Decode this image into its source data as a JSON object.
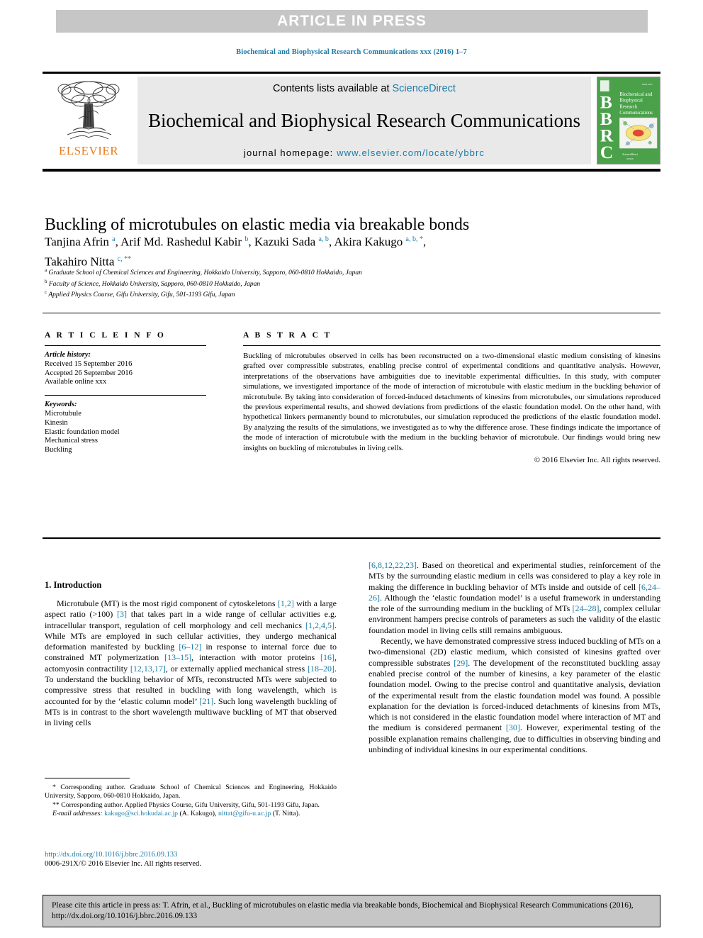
{
  "banner": {
    "label": "ARTICLE IN PRESS"
  },
  "running_head": "Biochemical and Biophysical Research Communications xxx (2016) 1–7",
  "masthead": {
    "contents_prefix": "Contents lists available at ",
    "sciencedirect": "ScienceDirect",
    "journal_title": "Biochemical and Biophysical Research Communications",
    "homepage_label": "journal homepage: ",
    "homepage_url": "www.elsevier.com/locate/ybbrc",
    "publisher": "ELSEVIER",
    "cover": {
      "letters": "BBRC",
      "title_lines": [
        "Biochemical and",
        "Biophysical",
        "Research",
        "Communications"
      ],
      "bg_color": "#4aa14a"
    }
  },
  "article": {
    "title": "Buckling of microtubules on elastic media via breakable bonds",
    "authors_line1_part1": "Tanjina Afrin ",
    "authors_line1_sup1": "a",
    "authors_line1_part2": ", Arif Md. Rashedul Kabir ",
    "authors_line1_sup2": "b",
    "authors_line1_part3": ", Kazuki Sada ",
    "authors_line1_sup3": "a, b",
    "authors_line1_part4": ", Akira Kakugo ",
    "authors_line1_sup4": "a, b, *",
    "authors_line1_part5": ",",
    "authors_line2_part1": "Takahiro Nitta ",
    "authors_line2_sup1": "c, **",
    "affiliations": [
      {
        "marker": "a",
        "text": "Graduate School of Chemical Sciences and Engineering, Hokkaido University, Sapporo, 060-0810 Hokkaido, Japan"
      },
      {
        "marker": "b",
        "text": "Faculty of Science, Hokkaido University, Sapporo, 060-0810 Hokkaido, Japan"
      },
      {
        "marker": "c",
        "text": "Applied Physics Course, Gifu University, Gifu, 501-1193 Gifu, Japan"
      }
    ]
  },
  "article_info": {
    "heading": "A R T I C L E  I N F O",
    "history_label": "Article history:",
    "history": [
      "Received 15 September 2016",
      "Accepted 26 September 2016",
      "Available online xxx"
    ],
    "keywords_label": "Keywords:",
    "keywords": [
      "Microtubule",
      "Kinesin",
      "Elastic foundation model",
      "Mechanical stress",
      "Buckling"
    ]
  },
  "abstract": {
    "heading": "A B S T R A C T",
    "text": "Buckling of microtubules observed in cells has been reconstructed on a two-dimensional elastic medium consisting of kinesins grafted over compressible substrates, enabling precise control of experimental conditions and quantitative analysis. However, interpretations of the observations have ambiguities due to inevitable experimental difficulties. In this study, with computer simulations, we investigated importance of the mode of interaction of microtubule with elastic medium in the buckling behavior of microtubule. By taking into consideration of forced-induced detachments of kinesins from microtubules, our simulations reproduced the previous experimental results, and showed deviations from predictions of the elastic foundation model. On the other hand, with hypothetical linkers permanently bound to microtubules, our simulation reproduced the predictions of the elastic foundation model. By analyzing the results of the simulations, we investigated as to why the difference arose. These findings indicate the importance of the mode of interaction of microtubule with the medium in the buckling behavior of microtubule. Our findings would bring new insights on buckling of microtubules in living cells.",
    "copyright": "© 2016 Elsevier Inc. All rights reserved."
  },
  "body": {
    "section_title": "1.  Introduction",
    "left_par1_a": "Microtubule (MT) is the most rigid component of cytoskeletons ",
    "left_par1_r1": "[1,2]",
    "left_par1_b": " with a large aspect ratio (>100) ",
    "left_par1_r2": "[3]",
    "left_par1_c": " that takes part in a wide range of cellular activities e.g. intracellular transport, regulation of cell morphology and cell mechanics ",
    "left_par1_r3": "[1,2,4,5]",
    "left_par1_d": ". While MTs are employed in such cellular activities, they undergo mechanical deformation manifested by buckling ",
    "left_par1_r4": "[6–12]",
    "left_par1_e": " in response to internal force due to constrained MT polymerization ",
    "left_par1_r5": "[13–15]",
    "left_par1_f": ", interaction with motor proteins ",
    "left_par1_r6": "[16]",
    "left_par1_g": ", actomyosin contractility ",
    "left_par1_r7": "[12,13,17]",
    "left_par1_h": ", or externally applied mechanical stress ",
    "left_par1_r8": "[18–20]",
    "left_par1_i": ". To understand the buckling behavior of MTs, reconstructed MTs were subjected to compressive stress that resulted in buckling with long wavelength, which is accounted for by the ‘elastic column model’ ",
    "left_par1_r9": "[21]",
    "left_par1_j": ". Such long wavelength buckling of MTs is in contrast to the short wavelength multiwave buckling of MT that observed in living cells",
    "right_par1_r1": "[6,8,12,22,23]",
    "right_par1_a": ". Based on theoretical and experimental studies, reinforcement of the MTs by the surrounding elastic medium in cells was considered to play a key role in making the difference in buckling behavior of MTs inside and outside of cell ",
    "right_par1_r2": "[6,24–26]",
    "right_par1_b": ". Although the ‘elastic foundation model’ is a useful framework in understanding the role of the surrounding medium in the buckling of MTs ",
    "right_par1_r3": "[24–28]",
    "right_par1_c": ", complex cellular environment hampers precise controls of parameters as such the validity of the elastic foundation model in living cells still remains ambiguous.",
    "right_par2_a": "Recently, we have demonstrated compressive stress induced buckling of MTs on a two-dimensional (2D) elastic medium, which consisted of kinesins grafted over compressible substrates ",
    "right_par2_r1": "[29]",
    "right_par2_b": ". The development of the reconstituted buckling assay enabled precise control of the number of kinesins, a key parameter of the elastic foundation model. Owing to the precise control and quantitative analysis, deviation of the experimental result from the elastic foundation model was found. A possible explanation for the deviation is forced-induced detachments of kinesins from MTs, which is not considered in the elastic foundation model where interaction of MT and the medium is considered permanent ",
    "right_par2_r2": "[30]",
    "right_par2_c": ". However, experimental testing of the possible explanation remains challenging, due to difficulties in observing binding and unbinding of individual kinesins in our experimental conditions."
  },
  "footnotes": {
    "fn1": "* Corresponding author. Graduate School of Chemical Sciences and Engineering, Hokkaido University, Sapporo, 060-0810 Hokkaido, Japan.",
    "fn2": "** Corresponding author. Applied Physics Course, Gifu University, Gifu, 501-1193 Gifu, Japan.",
    "email_label": "E-mail addresses:",
    "email1": "kakugo@sci.hokudai.ac.jp",
    "email1_name": "(A. Kakugo)",
    "email2": "nittat@gifu-u.ac.jp",
    "email2_name": "(T. Nitta)."
  },
  "doi_block": {
    "doi_url": "http://dx.doi.org/10.1016/j.bbrc.2016.09.133",
    "issn_line": "0006-291X/© 2016 Elsevier Inc. All rights reserved."
  },
  "cite_box": {
    "text": "Please cite this article in press as: T. Afrin, et al., Buckling of microtubules on elastic media via breakable bonds, Biochemical and Biophysical Research Communications (2016), http://dx.doi.org/10.1016/j.bbrc.2016.09.133"
  },
  "colors": {
    "link": "#1a7ba8",
    "banner_bg": "#c6c6c6",
    "panel_bg": "#e9e9e9",
    "elsevier_orange": "#e87d1e",
    "cover_green": "#4aa14a"
  }
}
